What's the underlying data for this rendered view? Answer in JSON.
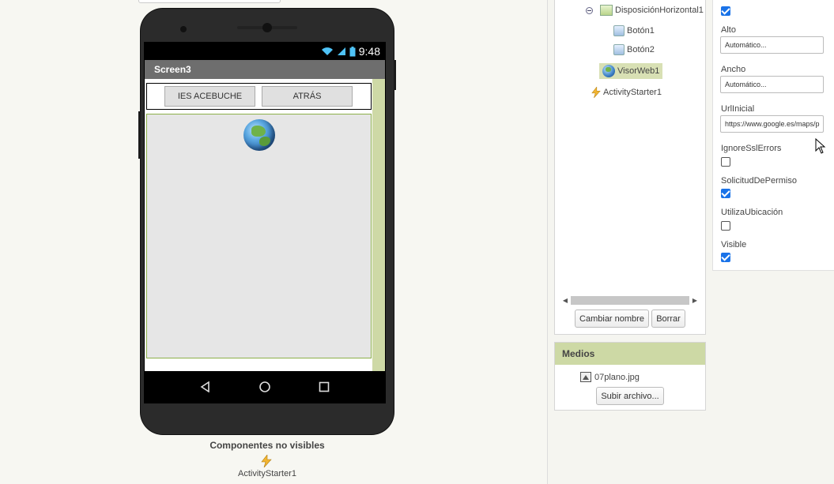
{
  "viewer": {
    "screen_title": "Screen3",
    "status_time": "9:48",
    "buttons": [
      "IES ACEBUCHE",
      "ATRÁS"
    ],
    "nonvisible_title": "Componentes no visibles",
    "nonvisible_component": "ActivityStarter1"
  },
  "components": {
    "items": [
      {
        "label": "DisposiciónHorizontal1",
        "icon": "horizontal-arrangement-icon"
      },
      {
        "label": "Botón1",
        "icon": "button-icon"
      },
      {
        "label": "Botón2",
        "icon": "button-icon"
      },
      {
        "label": "VisorWeb1",
        "icon": "web-viewer-globe-icon",
        "selected": true
      },
      {
        "label": "ActivityStarter1",
        "icon": "activity-starter-icon"
      }
    ],
    "rename_button": "Cambiar nombre",
    "delete_button": "Borrar"
  },
  "media": {
    "header": "Medios",
    "file": "07plano.jpg",
    "upload_button": "Subir archivo..."
  },
  "properties": {
    "top_checkbox_checked": true,
    "alto_label": "Alto",
    "alto_value": "Automático...",
    "ancho_label": "Ancho",
    "ancho_value": "Automático...",
    "url_label": "UrlInicial",
    "url_value": "https://www.google.es/maps/p",
    "ignoressl_label": "IgnoreSslErrors",
    "ignoressl_checked": false,
    "permiso_label": "SolicitudDePermiso",
    "permiso_checked": true,
    "ubicacion_label": "UtilizaUbicación",
    "ubicacion_checked": false,
    "visible_label": "Visible",
    "visible_checked": true
  },
  "colors": {
    "accent_green": "#cdd9a5",
    "checkbox_blue": "#1a73e8"
  }
}
